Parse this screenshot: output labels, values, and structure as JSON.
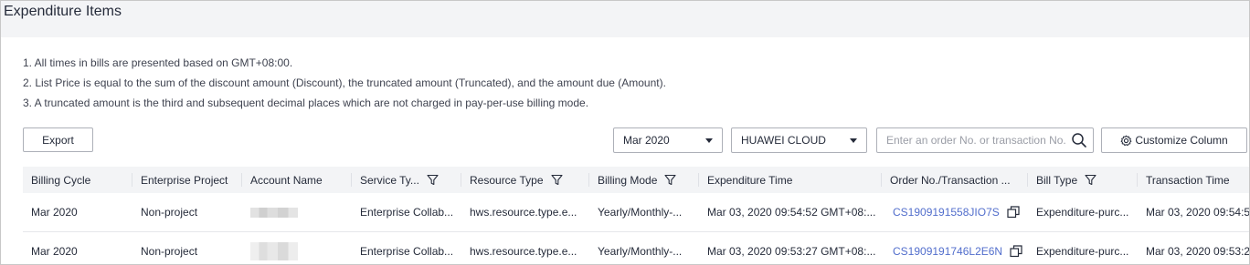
{
  "header": {
    "title": "Expenditure Items"
  },
  "notes": [
    "1. All times in bills are presented based on GMT+08:00.",
    "2. List Price is equal to the sum of the discount amount (Discount), the truncated amount (Truncated), and the amount due (Amount).",
    "3. A truncated amount is the third and subsequent decimal places which are not charged in pay-per-use billing mode."
  ],
  "toolbar": {
    "export_label": "Export",
    "month_value": "Mar 2020",
    "cloud_value": "HUAWEI CLOUD",
    "search_placeholder": "Enter an order No. or transaction No.",
    "customize_label": "Customize Column"
  },
  "table": {
    "columns": [
      "Billing Cycle",
      "Enterprise Project",
      "Account Name",
      "Service Ty...",
      "Resource Type",
      "Billing Mode",
      "Expenditure Time",
      "Order No./Transaction ...",
      "Bill Type",
      "Transaction Time"
    ],
    "rows": [
      {
        "billing_cycle": "Mar 2020",
        "enterprise_project": "Non-project",
        "account_name": "",
        "service_type": "Enterprise Collab...",
        "resource_type": "hws.resource.type.e...",
        "billing_mode": "Yearly/Monthly-...",
        "expenditure_time": "Mar 03, 2020 09:54:52 GMT+08:...",
        "order_no": "CS1909191558JIO7S",
        "bill_type": "Expenditure-purc...",
        "transaction_time": "Mar 03, 2020 09:54:5"
      },
      {
        "billing_cycle": "Mar 2020",
        "enterprise_project": "Non-project",
        "account_name": "",
        "service_type": "Enterprise Collab...",
        "resource_type": "hws.resource.type.e...",
        "billing_mode": "Yearly/Monthly-...",
        "expenditure_time": "Mar 03, 2020 09:53:27 GMT+08:...",
        "order_no": "CS1909191746L2E6N",
        "bill_type": "Expenditure-purc...",
        "transaction_time": "Mar 03, 2020 09:53:2"
      }
    ]
  },
  "icons": {
    "filter": "funnel-filter-icon",
    "search": "search-icon",
    "gear": "gear-icon",
    "copy": "copy-icon",
    "dropdown": "caret-down-icon"
  },
  "colors": {
    "link": "#526ecc",
    "header_bg": "#f3f4f6",
    "border": "#adb0b8"
  }
}
